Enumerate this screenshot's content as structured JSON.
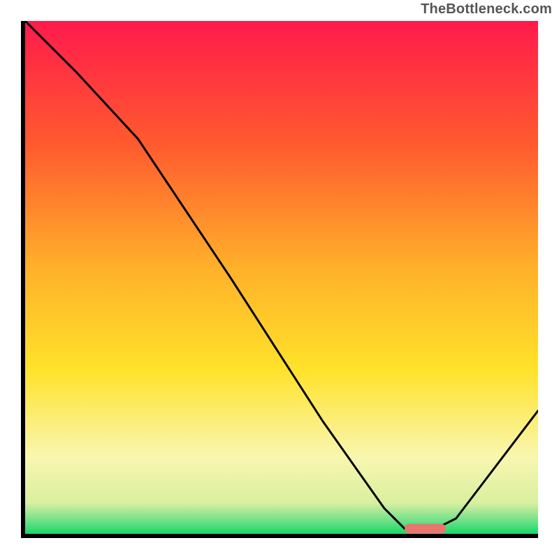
{
  "watermark": "TheBottleneck.com",
  "colors": {
    "gradient_top": "#ff1a4b",
    "gradient_mid_orange": "#ff9a2a",
    "gradient_yellow": "#ffe22a",
    "gradient_pale": "#f9f6b0",
    "gradient_green": "#17d86b",
    "curve": "#000000",
    "axis": "#000000",
    "marker": "#e8766f"
  },
  "chart_data": {
    "type": "line",
    "title": "",
    "xlabel": "",
    "ylabel": "",
    "xlim": [
      0,
      100
    ],
    "ylim": [
      0,
      100
    ],
    "grid": false,
    "legend": false,
    "annotations": [],
    "series": [
      {
        "name": "curve",
        "x": [
          0,
          10,
          22,
          40,
          58,
          70,
          74,
          80,
          84,
          100
        ],
        "y": [
          100,
          90,
          77,
          50,
          22,
          5,
          1,
          1,
          3,
          24
        ]
      }
    ],
    "marker": {
      "x_start": 74,
      "x_end": 82,
      "y": 1
    },
    "gradient_stops_pct": [
      {
        "pct": 0,
        "color": "#ff1a4b"
      },
      {
        "pct": 24,
        "color": "#ff5a2f"
      },
      {
        "pct": 48,
        "color": "#ffb02a"
      },
      {
        "pct": 68,
        "color": "#ffe22a"
      },
      {
        "pct": 85,
        "color": "#f9f6b0"
      },
      {
        "pct": 94,
        "color": "#d9efa0"
      },
      {
        "pct": 97,
        "color": "#7de28c"
      },
      {
        "pct": 100,
        "color": "#17d86b"
      }
    ],
    "note": "Values estimated from pixel positions; axes unlabeled in source."
  }
}
